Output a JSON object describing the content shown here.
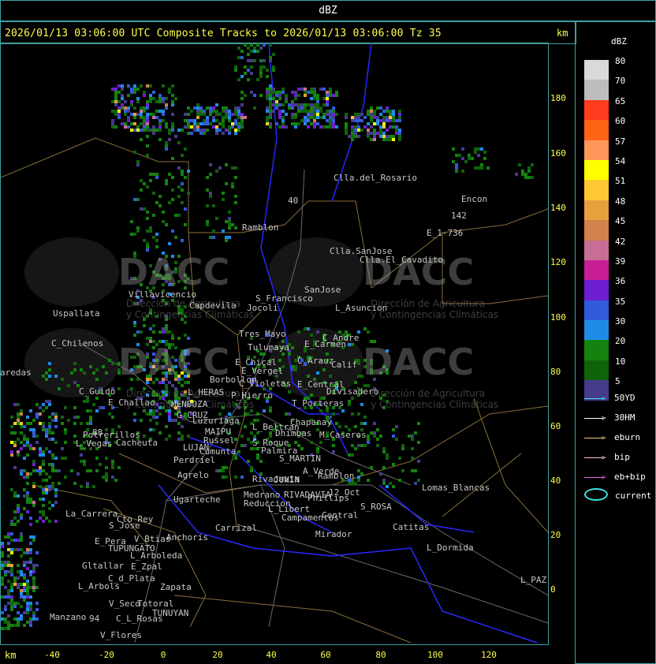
{
  "window": {
    "title": "dBZ"
  },
  "header": {
    "headline": "2026/01/13 03:06:00 UTC Composite Tracks to 2026/01/13 03:06:00 Tz 35",
    "km_top": "km",
    "km_bottom": "km"
  },
  "legend": {
    "title": "dBZ",
    "scale": [
      {
        "label": "80",
        "color": "#d9d9d9"
      },
      {
        "label": "70",
        "color": "#bdbdbd"
      },
      {
        "label": "65",
        "color": "#ff3c1e"
      },
      {
        "label": "60",
        "color": "#ff6414"
      },
      {
        "label": "57",
        "color": "#ff965a"
      },
      {
        "label": "54",
        "color": "#ffff00"
      },
      {
        "label": "51",
        "color": "#ffc832"
      },
      {
        "label": "48",
        "color": "#e6a03c"
      },
      {
        "label": "45",
        "color": "#d2824b"
      },
      {
        "label": "42",
        "color": "#c86e96"
      },
      {
        "label": "39",
        "color": "#c81e96"
      },
      {
        "label": "36",
        "color": "#6e1ed2"
      },
      {
        "label": "35",
        "color": "#325adc"
      },
      {
        "label": "30",
        "color": "#1e8ce6"
      },
      {
        "label": "20",
        "color": "#14820f"
      },
      {
        "label": "10",
        "color": "#0f640a"
      },
      {
        "label": "5",
        "color": "#463c8c"
      }
    ],
    "tracks": [
      {
        "label": "50YD",
        "color": "#40e0e0"
      },
      {
        "label": "30HM",
        "color": "#ffffff"
      },
      {
        "label": "eburn",
        "color": "#f0c878"
      },
      {
        "label": "bip",
        "color": "#ffc8d2"
      },
      {
        "label": "eb+bip",
        "color": "#e664e6"
      }
    ],
    "current_label": "current",
    "current_color": "#40e0e0"
  },
  "axes": {
    "y_ticks": [
      "180",
      "160",
      "140",
      "120",
      "100",
      "80",
      "60",
      "40",
      "20",
      "0"
    ],
    "x_ticks": [
      "-40",
      "-20",
      "0",
      "20",
      "40",
      "60",
      "80",
      "100",
      "120"
    ]
  },
  "places": [
    {
      "name": "Clla.del_Rosario"
    },
    {
      "name": "Encon"
    },
    {
      "name": "142"
    },
    {
      "name": "E_1-736"
    },
    {
      "name": "Ramblon"
    },
    {
      "name": "Clla.SanJose"
    },
    {
      "name": "Clla.El_Cavadito"
    },
    {
      "name": "Villavicencio"
    },
    {
      "name": "Capdevila"
    },
    {
      "name": "S_Francisco"
    },
    {
      "name": "Jocoli"
    },
    {
      "name": "SanJose"
    },
    {
      "name": "L_Asuncion"
    },
    {
      "name": "Uspallata"
    },
    {
      "name": "Tres_Mayo"
    },
    {
      "name": "C_Andre"
    },
    {
      "name": "Tulumaya"
    },
    {
      "name": "E_Carmen"
    },
    {
      "name": "C_Chilenos"
    },
    {
      "name": "E_Chical"
    },
    {
      "name": "C_Arauz"
    },
    {
      "name": "Calif"
    },
    {
      "name": "E_Vergel"
    },
    {
      "name": "aredas"
    },
    {
      "name": "Borbollon"
    },
    {
      "name": "C_Violetas"
    },
    {
      "name": "E_Central"
    },
    {
      "name": "Divisadero"
    },
    {
      "name": "C_Guido"
    },
    {
      "name": "L_HERAS"
    },
    {
      "name": "P_Hierro"
    },
    {
      "name": "E_Challao"
    },
    {
      "name": "MENDOZA"
    },
    {
      "name": "T_Porteras"
    },
    {
      "name": "G_CRUZ"
    },
    {
      "name": "Luzuriaga"
    },
    {
      "name": "Chapanay"
    },
    {
      "name": "Russel"
    },
    {
      "name": "L_Beltran"
    },
    {
      "name": "MAIPU"
    },
    {
      "name": "Dhimbas"
    },
    {
      "name": "M_Caseros"
    },
    {
      "name": "Potrerillos"
    },
    {
      "name": "Cacheuta"
    },
    {
      "name": "LUJAN"
    },
    {
      "name": "Cumunta"
    },
    {
      "name": "S_Roque"
    },
    {
      "name": "L_Vegas"
    },
    {
      "name": "Palmira"
    },
    {
      "name": "Perdriel"
    },
    {
      "name": "S_MARTIN"
    },
    {
      "name": "A_Verde"
    },
    {
      "name": "Agrelo"
    },
    {
      "name": "Rivadavia"
    },
    {
      "name": "Ramblon"
    },
    {
      "name": "JUNIN"
    },
    {
      "name": "Ugarteche"
    },
    {
      "name": "12_Oct"
    },
    {
      "name": "Lomas_Blancas"
    },
    {
      "name": "Medrano"
    },
    {
      "name": "RIVADAVIA"
    },
    {
      "name": "Phillips"
    },
    {
      "name": "Reduccion"
    },
    {
      "name": "L_Libert"
    },
    {
      "name": "S_ROSA"
    },
    {
      "name": "La_Carrera"
    },
    {
      "name": "Cto_Rey"
    },
    {
      "name": "S_Jose"
    },
    {
      "name": "Campamentos"
    },
    {
      "name": "Central"
    },
    {
      "name": "Catitas"
    },
    {
      "name": "Carrizal"
    },
    {
      "name": "E_Pera"
    },
    {
      "name": "V_Btias"
    },
    {
      "name": "Anchoris"
    },
    {
      "name": "Mirador"
    },
    {
      "name": "TUPUNGATO"
    },
    {
      "name": "L_Dormida"
    },
    {
      "name": "L_Arboleda"
    },
    {
      "name": "Gltallar"
    },
    {
      "name": "E_Zpal"
    },
    {
      "name": "C_d_Plata"
    },
    {
      "name": "L_PAZ"
    },
    {
      "name": "L_Arbols"
    },
    {
      "name": "Zapata"
    },
    {
      "name": "V_Seco"
    },
    {
      "name": "Totoral"
    },
    {
      "name": "TUNUYAN"
    },
    {
      "name": "Manzano"
    },
    {
      "name": "C_L_Rosas"
    },
    {
      "name": "V_Flores"
    },
    {
      "name": "88"
    },
    {
      "name": "40"
    },
    {
      "name": "94"
    }
  ],
  "watermark": {
    "brand": "DACC",
    "subtitle1": "Dirección de Agricultura",
    "subtitle2": "y Contingencias Climáticas"
  }
}
